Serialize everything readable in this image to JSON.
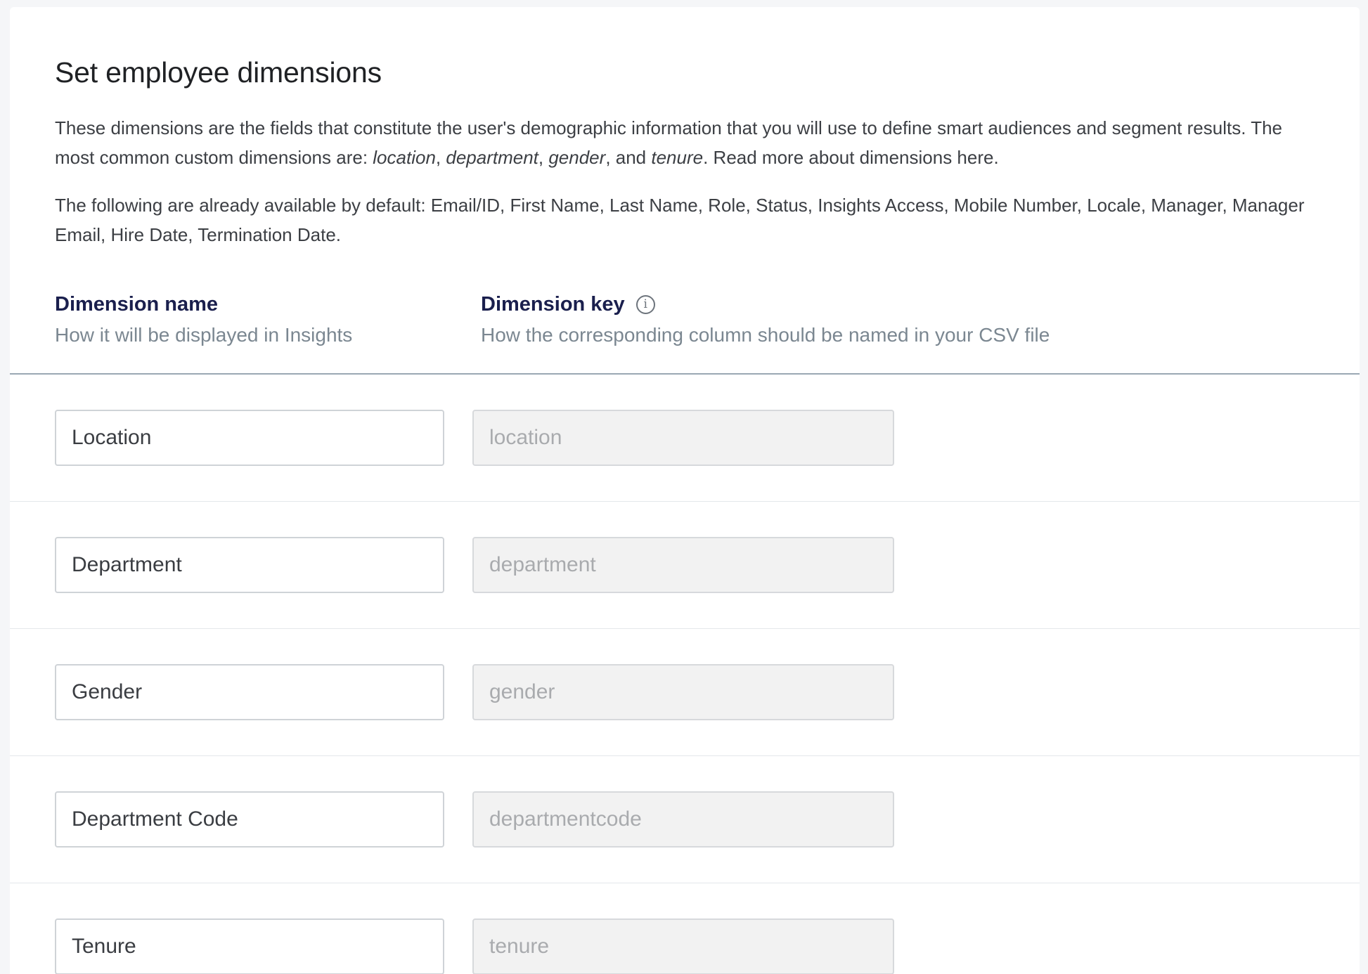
{
  "page": {
    "title": "Set employee dimensions",
    "intro": {
      "line1_text": "These dimensions are the fields that constitute the user's demographic information that you will use to define smart audiences and segment results.",
      "line2_prefix": "The most common custom dimensions are: ",
      "examples": [
        "location",
        "department",
        "gender",
        "tenure"
      ],
      "sep_comma": ", ",
      "sep_and": ", and ",
      "line2_suffix": ". Read more about dimensions here.",
      "defaults_text": "The following are already available by default: Email/ID, First Name, Last Name, Role, Status, Insights Access, Mobile Number, Locale, Manager, Manager Email, Hire Date, Termination Date."
    }
  },
  "columns": {
    "name": {
      "title": "Dimension name",
      "subtitle": "How it will be displayed in Insights"
    },
    "key": {
      "title": "Dimension key",
      "subtitle": "How the corresponding column should be named in your CSV file",
      "info_icon": "info-circle-icon"
    }
  },
  "dimensions": [
    {
      "name": "Location",
      "key": "location"
    },
    {
      "name": "Department",
      "key": "department"
    },
    {
      "name": "Gender",
      "key": "gender"
    },
    {
      "name": "Department Code",
      "key": "departmentcode"
    },
    {
      "name": "Tenure",
      "key": "tenure"
    }
  ]
}
